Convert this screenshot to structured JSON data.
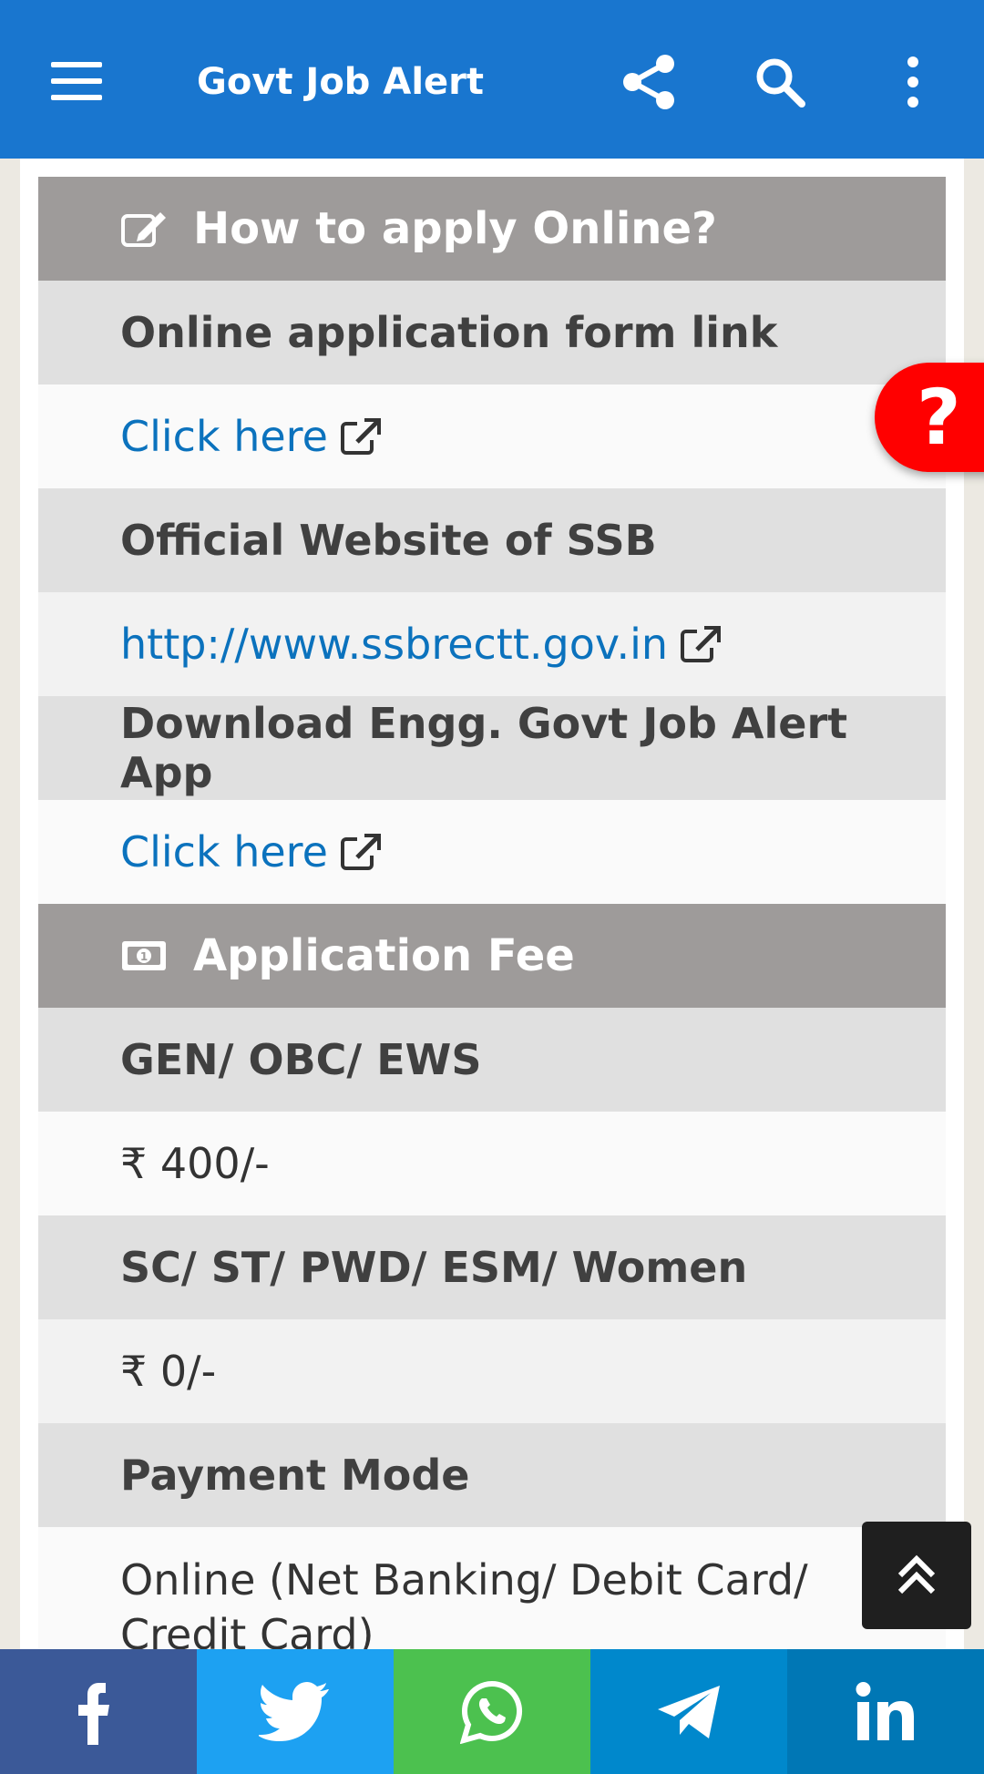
{
  "appbar": {
    "title": "Govt Job Alert",
    "menu_icon": "hamburger-menu-icon",
    "share_icon": "share-icon",
    "search_icon": "search-icon",
    "more_icon": "more-vertical-icon",
    "color": "#1976cf"
  },
  "sections": {
    "apply": {
      "title": "How to apply Online?",
      "icon": "edit-icon",
      "rows": [
        {
          "label": "Online application form link",
          "value": "Click here"
        },
        {
          "label": "Official Website of SSB",
          "value": "http://www.ssbrectt.gov.in"
        },
        {
          "label": "Download Engg. Govt Job Alert App",
          "value": "Click here"
        }
      ]
    },
    "fee": {
      "title": "Application Fee",
      "icon": "money-bill-icon",
      "rows": [
        {
          "label": "GEN/ OBC/ EWS",
          "value": "₹ 400/-"
        },
        {
          "label": "SC/ ST/ PWD/ ESM/ Women",
          "value": "₹ 0/-"
        },
        {
          "label": "Payment Mode",
          "value": "Online (Net Banking/ Debit Card/ Credit Card)"
        }
      ]
    }
  },
  "help_fab": {
    "label": "?",
    "color": "#ff0000"
  },
  "back_to_top_icon": "double-chevron-up-icon",
  "share_bar": [
    {
      "name": "facebook",
      "icon": "facebook-icon",
      "color": "#3b5998"
    },
    {
      "name": "twitter",
      "icon": "twitter-icon",
      "color": "#1da1f2"
    },
    {
      "name": "whatsapp",
      "icon": "whatsapp-icon",
      "color": "#4cc14f"
    },
    {
      "name": "telegram",
      "icon": "telegram-icon",
      "color": "#0088cc"
    },
    {
      "name": "linkedin",
      "icon": "linkedin-icon",
      "color": "#0077b5"
    }
  ]
}
